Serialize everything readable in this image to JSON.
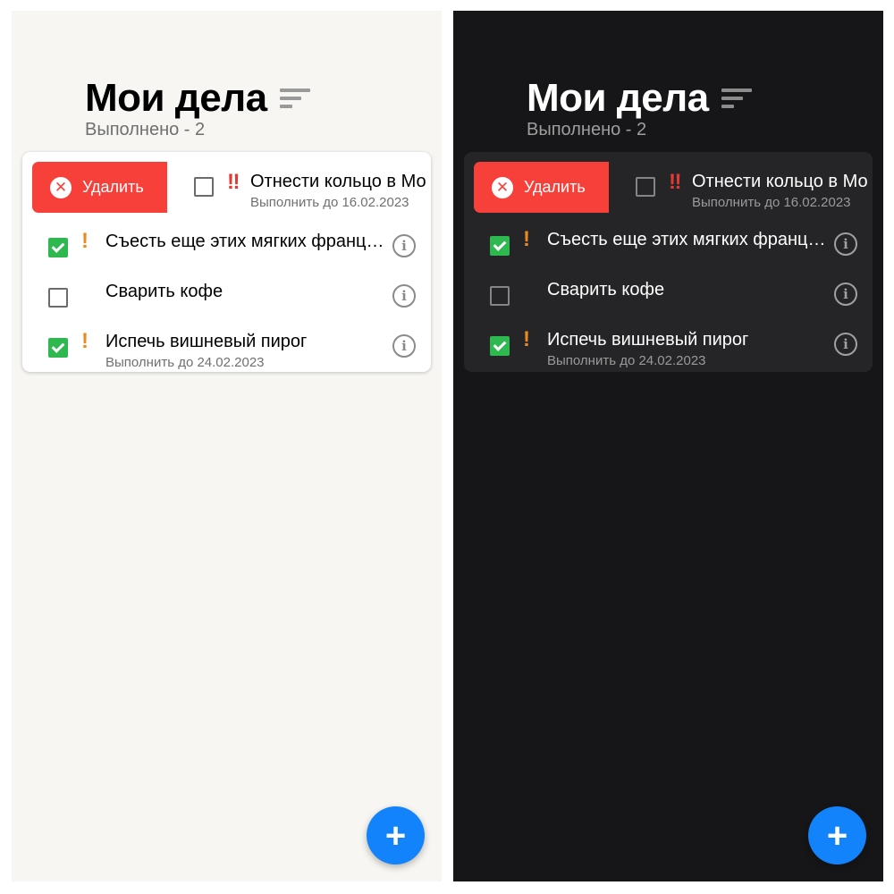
{
  "header": {
    "title": "Мои дела",
    "done_count": "Выполнено - 2"
  },
  "swipe_action": {
    "delete_label": "Удалить",
    "icon": "x-circle-icon",
    "color": "#f8403a"
  },
  "tasks": [
    {
      "text": "Отнести кольцо в Мо",
      "priority": "‼",
      "done": false,
      "deadline": "Выполнить до 16.02.2023"
    },
    {
      "text": "Съесть еще этих мягких франц…",
      "priority": "!",
      "done": true
    },
    {
      "text": "Сварить кофе",
      "priority": "",
      "done": false
    },
    {
      "text": "Испечь вишневый пирог",
      "priority": "!",
      "done": true,
      "deadline": "Выполнить до 24.02.2023"
    }
  ],
  "info_glyph": "i",
  "fab": {
    "label": "+",
    "color": "#1383fb"
  },
  "colors": {
    "checked": "#2eb84f",
    "priority_low": "#ec8a1f",
    "priority_high": "#e23a34",
    "light_bg": "#f7f6f2",
    "dark_bg": "#161618"
  }
}
